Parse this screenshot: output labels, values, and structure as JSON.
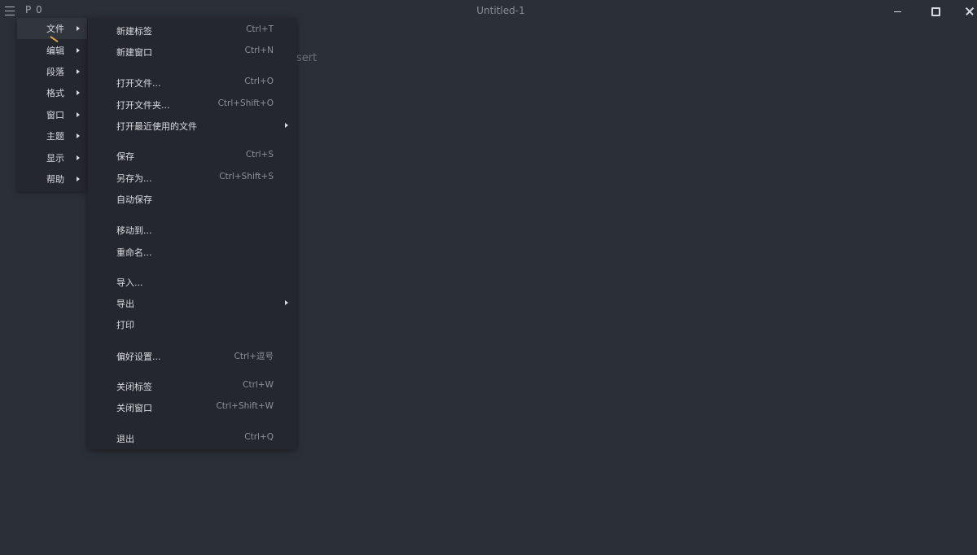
{
  "titlebar": {
    "counts": "P 0",
    "title": "Untitled-1"
  },
  "editor": {
    "hint": "sert"
  },
  "main_menu": {
    "items": [
      {
        "label": "文件"
      },
      {
        "label": "编辑"
      },
      {
        "label": "段落"
      },
      {
        "label": "格式"
      },
      {
        "label": "窗口"
      },
      {
        "label": "主题"
      },
      {
        "label": "显示"
      },
      {
        "label": "帮助"
      }
    ]
  },
  "file_menu": {
    "items": [
      {
        "label": "新建标签",
        "shortcut": "Ctrl+T"
      },
      {
        "label": "新建窗口",
        "shortcut": "Ctrl+N"
      },
      {
        "label": "打开文件...",
        "shortcut": "Ctrl+O"
      },
      {
        "label": "打开文件夹...",
        "shortcut": "Ctrl+Shift+O"
      },
      {
        "label": "打开最近使用的文件",
        "shortcut": ""
      },
      {
        "label": "保存",
        "shortcut": "Ctrl+S"
      },
      {
        "label": "另存为...",
        "shortcut": "Ctrl+Shift+S"
      },
      {
        "label": "自动保存",
        "shortcut": ""
      },
      {
        "label": "移动到...",
        "shortcut": ""
      },
      {
        "label": "重命名...",
        "shortcut": ""
      },
      {
        "label": "导入...",
        "shortcut": ""
      },
      {
        "label": "导出",
        "shortcut": ""
      },
      {
        "label": "打印",
        "shortcut": ""
      },
      {
        "label": "偏好设置...",
        "shortcut": "Ctrl+逗号"
      },
      {
        "label": "关闭标签",
        "shortcut": "Ctrl+W"
      },
      {
        "label": "关闭窗口",
        "shortcut": "Ctrl+Shift+W"
      },
      {
        "label": "退出",
        "shortcut": "Ctrl+Q"
      }
    ]
  }
}
